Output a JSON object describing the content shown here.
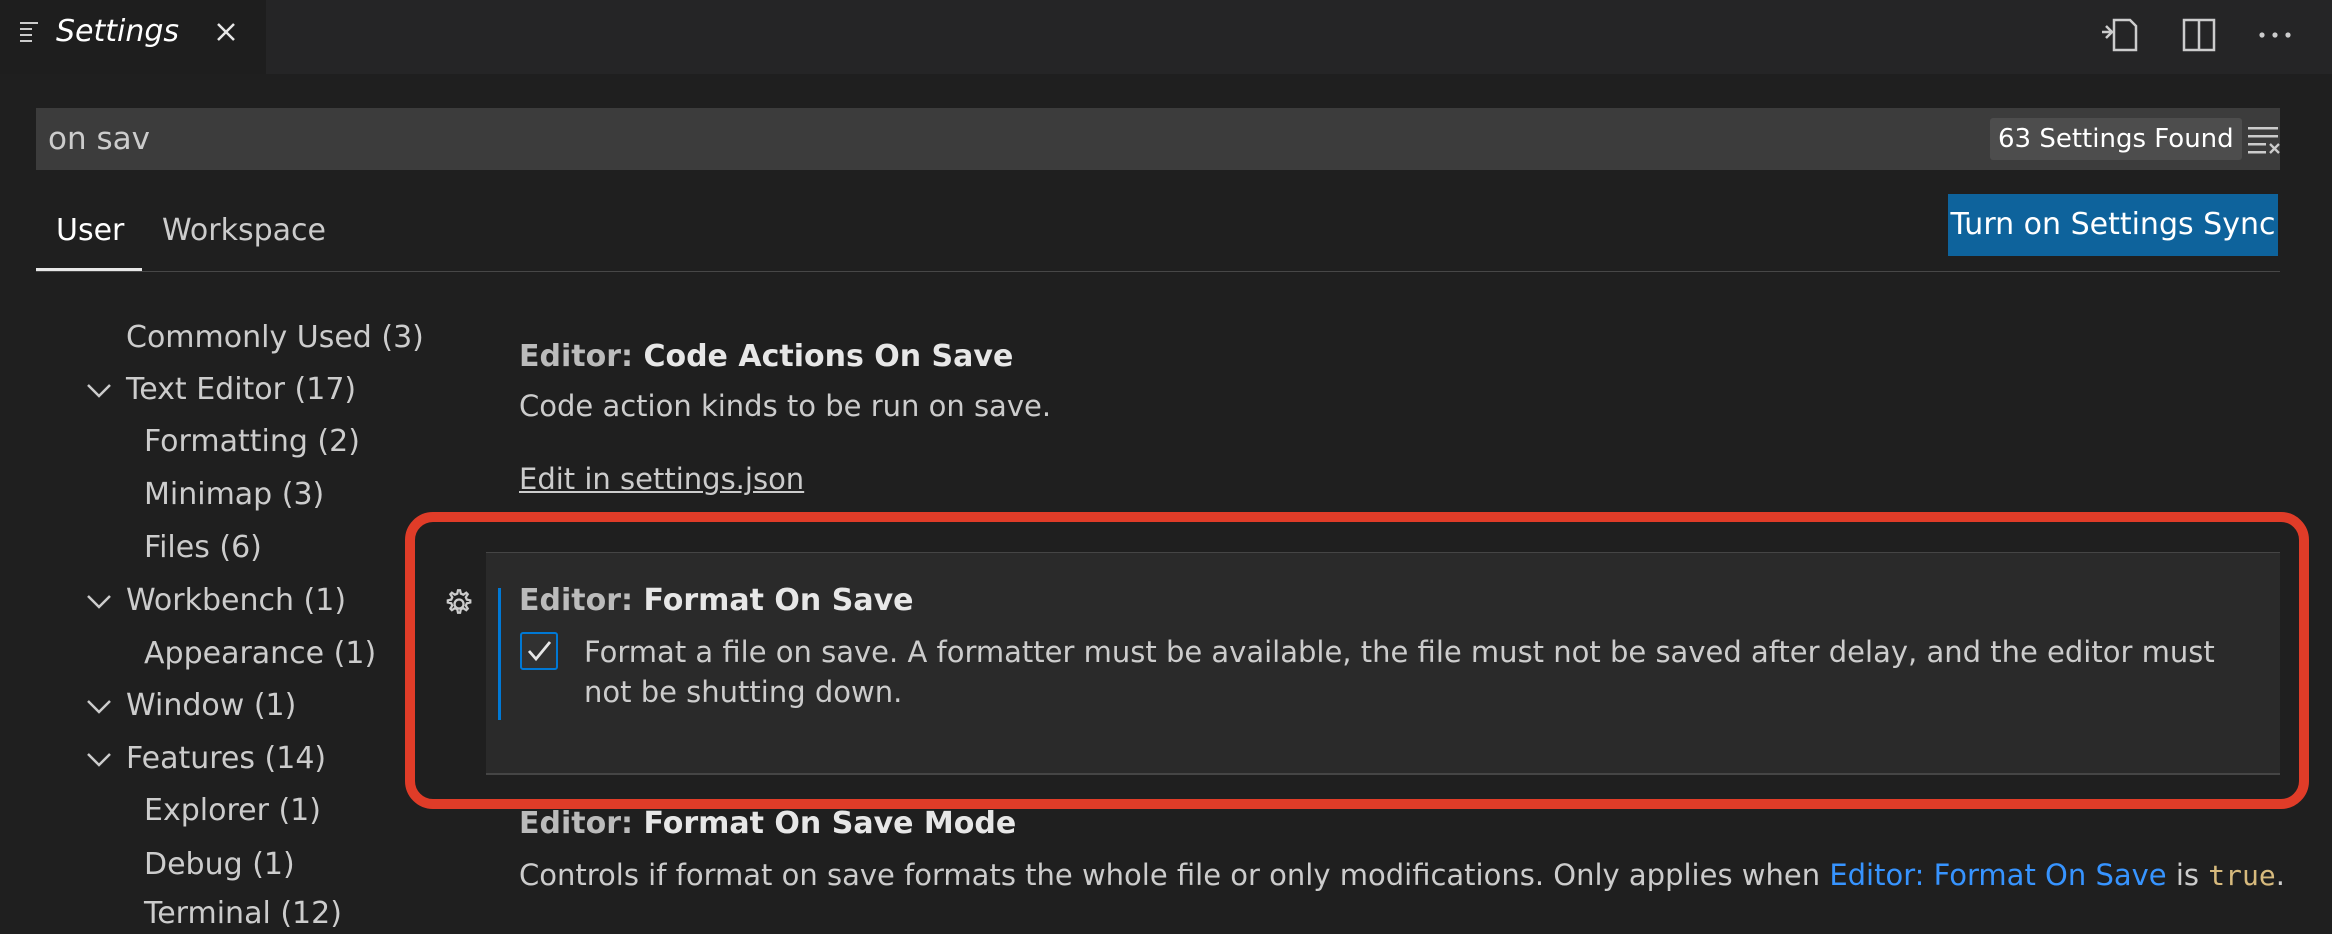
{
  "tab": {
    "title": "Settings"
  },
  "search": {
    "value": "on sav",
    "result_count": "63 Settings Found"
  },
  "scopes": {
    "user": "User",
    "workspace": "Workspace"
  },
  "sync_button": "Turn on Settings Sync",
  "toc": [
    {
      "label": "Commonly Used (3)"
    },
    {
      "label": "Text Editor (17)"
    },
    {
      "label": "Formatting (2)"
    },
    {
      "label": "Minimap (3)"
    },
    {
      "label": "Files (6)"
    },
    {
      "label": "Workbench (1)"
    },
    {
      "label": "Appearance (1)"
    },
    {
      "label": "Window (1)"
    },
    {
      "label": "Features (14)"
    },
    {
      "label": "Explorer (1)"
    },
    {
      "label": "Debug (1)"
    },
    {
      "label": "Terminal (12)"
    }
  ],
  "settings": [
    {
      "category": "Editor: ",
      "name": "Code Actions On Save",
      "description": "Code action kinds to be run on save.",
      "link": "Edit in settings.json"
    },
    {
      "category": "Editor: ",
      "name": "Format On Save",
      "description": "Format a file on save. A formatter must be available, the file must not be saved after delay, and the editor must not be shutting down.",
      "checked": true
    },
    {
      "category": "Editor: ",
      "name": "Format On Save Mode",
      "description_prefix": "Controls if format on save formats the whole file or only modifications. Only applies when ",
      "description_link": "Editor: Format On Save",
      "description_mid": " is ",
      "description_code": "true",
      "description_suffix": "."
    }
  ],
  "colors": {
    "accent": "#0078d4",
    "sync_button": "#0e639c",
    "highlight": "#e03c28",
    "link": "#3794ff"
  }
}
